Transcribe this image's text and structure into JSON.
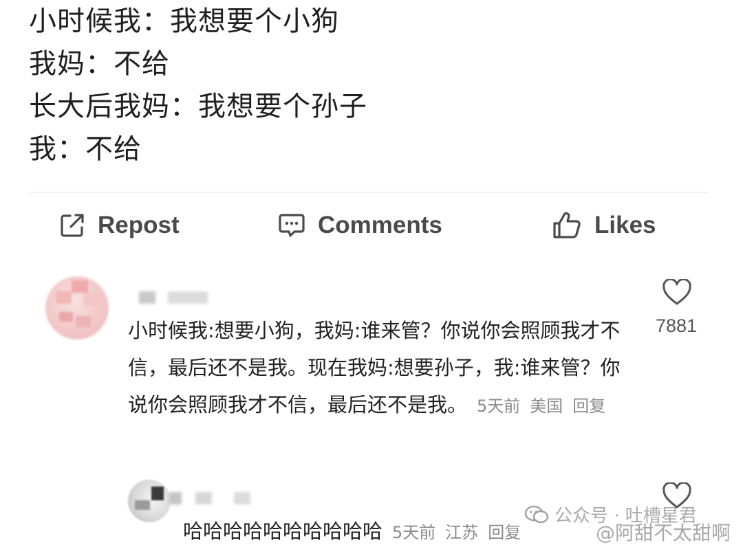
{
  "post": {
    "lines": [
      "小时候我：我想要个小狗",
      "我妈：不给",
      "长大后我妈：我想要个孙子",
      "我：不给"
    ]
  },
  "actions": {
    "repost": "Repost",
    "comments": "Comments",
    "likes": "Likes"
  },
  "comment": {
    "text": "小时候我:想要小狗，我妈:谁来管？你说你会照顾我才不信，最后还不是我。现在我妈:想要孙子，我:谁来管？你说你会照顾我才不信，最后还不是我。",
    "time": "5天前",
    "location": "美国",
    "reply_label": "回复",
    "likes": "7881"
  },
  "reply": {
    "text": "哈哈哈哈哈哈哈哈哈哈",
    "time": "5天前",
    "location": "江苏",
    "reply_label": "回复"
  },
  "watermarks": {
    "wechat": "公众号 · 吐槽星君",
    "weibo": "@阿甜不太甜啊"
  },
  "icons": {
    "repost": "repost-icon",
    "comments": "comment-icon",
    "likes": "thumbs-up-icon",
    "like_heart": "heart-icon"
  },
  "colors": {
    "text": "#222222",
    "muted": "#8a8a8a",
    "action_text": "#4a4a4a",
    "divider": "#efefef",
    "avatar_pink": "#f3c8c8"
  }
}
